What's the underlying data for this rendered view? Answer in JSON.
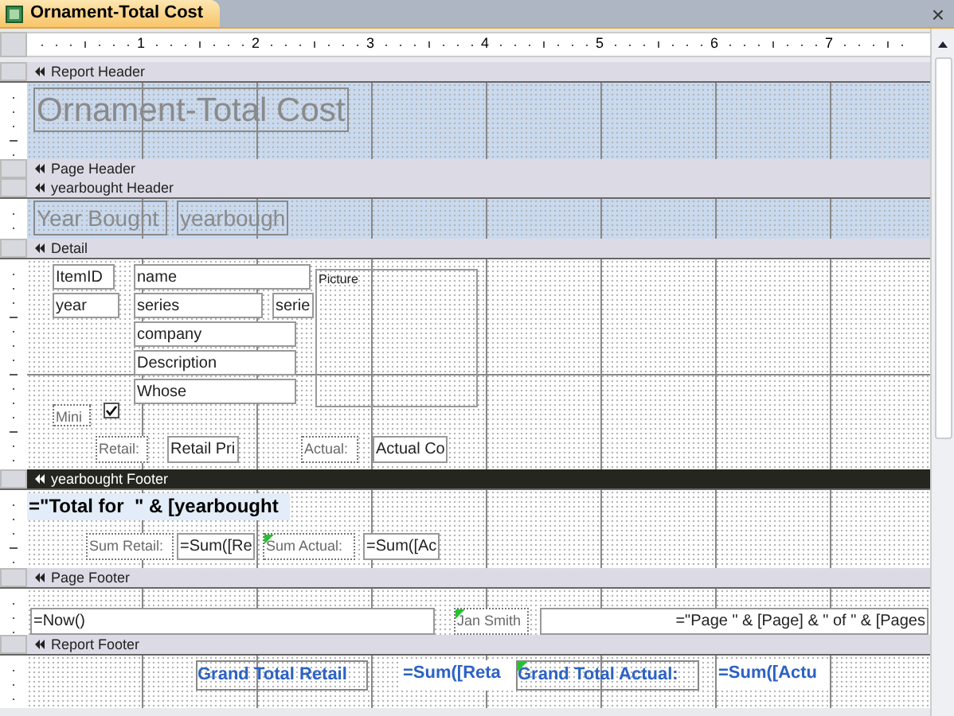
{
  "tab": {
    "title": "Ornament-Total Cost",
    "selected": true
  },
  "close": "×",
  "ruler": [
    "1",
    "2",
    "3",
    "4",
    "5",
    "6",
    "7"
  ],
  "sections": [
    {
      "title": "Report Header",
      "selected": false,
      "color": "#c9d9ee",
      "controls": [
        {
          "kind": "title",
          "text": "Ornament-Total Cost"
        }
      ]
    },
    {
      "title": "Page Header",
      "selected": false
    },
    {
      "title": "yearbought Header",
      "selected": false,
      "color": "#c9d9ee",
      "controls": [
        {
          "kind": "title",
          "text": "Year Bought"
        },
        {
          "kind": "title",
          "text": "yearbough"
        }
      ]
    },
    {
      "title": "Detail",
      "selected": false,
      "color": "#ffffff",
      "controls": [
        {
          "kind": "textbox",
          "text": "ItemID"
        },
        {
          "kind": "textbox",
          "text": "name"
        },
        {
          "kind": "image",
          "text": "Picture"
        },
        {
          "kind": "textbox",
          "text": "year"
        },
        {
          "kind": "textbox",
          "text": "series"
        },
        {
          "kind": "textbox",
          "text": "serie"
        },
        {
          "kind": "textbox",
          "text": "company"
        },
        {
          "kind": "textbox",
          "text": "Description"
        },
        {
          "kind": "textbox",
          "text": "Whose"
        },
        {
          "kind": "label",
          "text": "Mini"
        },
        {
          "kind": "checkbox",
          "checked": true
        },
        {
          "kind": "label",
          "text": "Retail:"
        },
        {
          "kind": "textbox",
          "text": "Retail Pri"
        },
        {
          "kind": "label",
          "text": "Actual:"
        },
        {
          "kind": "textbox",
          "text": "Actual Co"
        }
      ]
    },
    {
      "title": "yearbought Footer",
      "selected": true,
      "color": "#ffffff",
      "controls": [
        {
          "kind": "heading",
          "text": "=\"Total for  \" & [yearbought"
        },
        {
          "kind": "label",
          "text": "Sum Retail:",
          "error": false
        },
        {
          "kind": "textbox",
          "text": "=Sum([Re"
        },
        {
          "kind": "label",
          "text": "Sum Actual:",
          "error": true
        },
        {
          "kind": "textbox",
          "text": "=Sum([Ac"
        }
      ]
    },
    {
      "title": "Page Footer",
      "selected": false,
      "color": "#ffffff",
      "controls": [
        {
          "kind": "textbox",
          "text": "=Now()"
        },
        {
          "kind": "label",
          "text": "Jan Smith",
          "error": true
        },
        {
          "kind": "textbox-right",
          "text": "=\"Page \" & [Page] & \" of \" & [Pages"
        }
      ]
    },
    {
      "title": "Report Footer",
      "selected": false,
      "color": "#ffffff",
      "controls": [
        {
          "kind": "total",
          "text": "Grand Total Retail",
          "error": false
        },
        {
          "kind": "total-box",
          "text": "=Sum([Reta"
        },
        {
          "kind": "total",
          "text": "Grand Total Actual:",
          "error": true
        },
        {
          "kind": "total-box",
          "text": "=Sum([Actu"
        }
      ]
    }
  ]
}
